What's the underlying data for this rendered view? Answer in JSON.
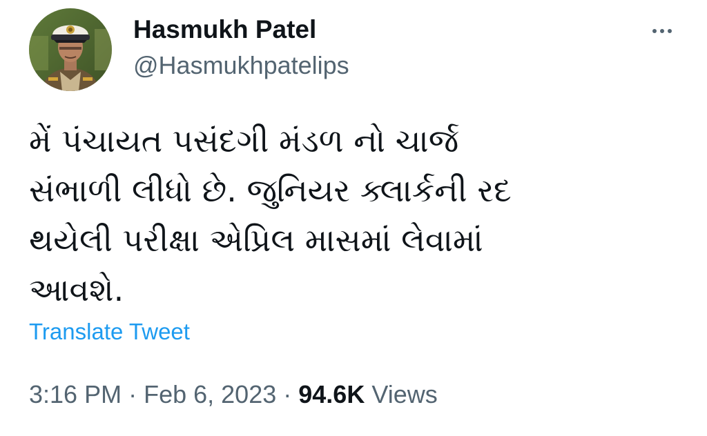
{
  "author": {
    "display_name": "Hasmukh Patel",
    "handle": "@Hasmukhpatelips",
    "avatar_icon": "profile-photo-police-officer"
  },
  "more_icon": "ellipsis-horizontal-icon",
  "tweet": {
    "text_lines": [
      "મેં પંચાયત પસંદગી મંડળ નો ચાર્જ",
      "સંભાળી લીધો છે. જુનિયર ક્લાર્કની રદ",
      "થયેલી પરીક્ષા એપ્રિલ માસમાં લેવામાં",
      "આવશે."
    ],
    "translate_label": "Translate Tweet"
  },
  "meta": {
    "time": "3:16 PM",
    "separator": "·",
    "date": "Feb 6, 2023",
    "views_count": "94.6K",
    "views_label": "Views"
  },
  "colors": {
    "text_primary": "#0f1419",
    "text_secondary": "#536471",
    "link": "#1d9bf0"
  }
}
